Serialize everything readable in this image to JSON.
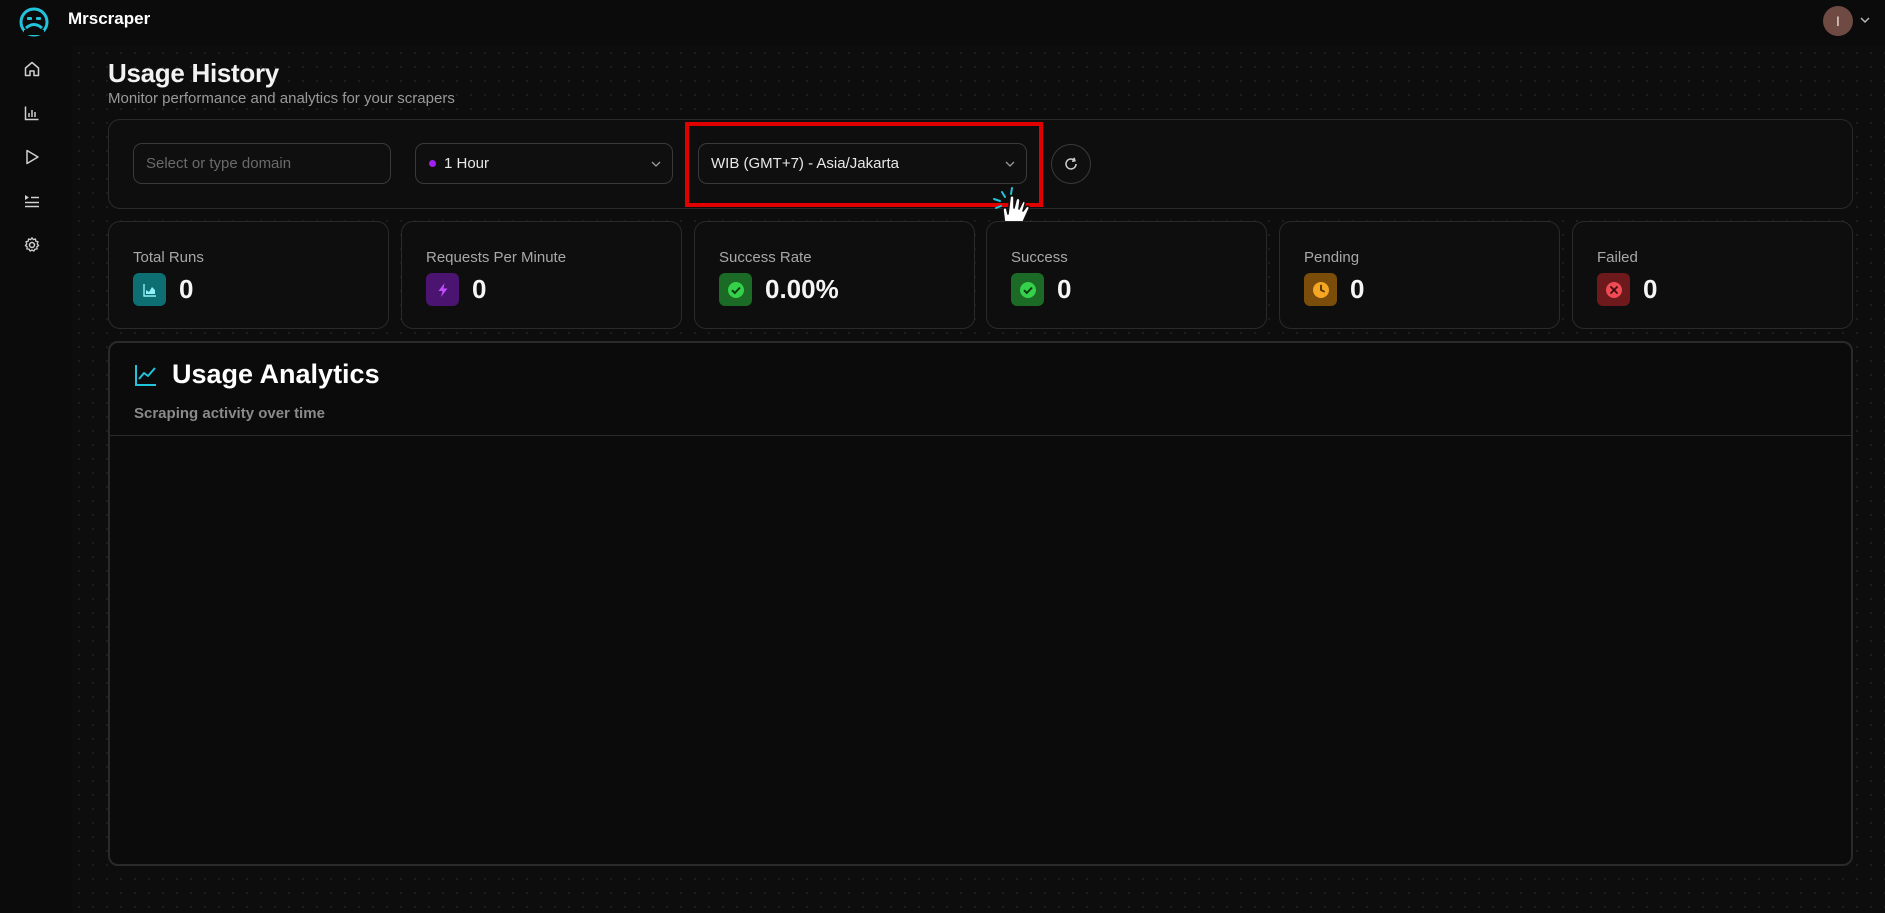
{
  "app": {
    "name": "Mrscraper"
  },
  "user": {
    "avatar_initial": "I"
  },
  "sidebar": {
    "items": [
      {
        "name": "home",
        "icon": "home-icon"
      },
      {
        "name": "usage",
        "icon": "bar-chart-icon"
      },
      {
        "name": "run",
        "icon": "play-icon"
      },
      {
        "name": "queue",
        "icon": "list-icon"
      },
      {
        "name": "settings",
        "icon": "gear-icon"
      }
    ]
  },
  "page": {
    "title": "Usage History",
    "subtitle": "Monitor performance and analytics for your scrapers"
  },
  "filters": {
    "domain_placeholder": "Select or type domain",
    "time_range": "1 Hour",
    "timezone": "WIB (GMT+7) - Asia/Jakarta"
  },
  "stats": [
    {
      "label": "Total Runs",
      "value": "0",
      "icon": "area-chart-icon",
      "color": "#0e6f73"
    },
    {
      "label": "Requests Per Minute",
      "value": "0",
      "icon": "lightning-icon",
      "color": "#4a1470"
    },
    {
      "label": "Success Rate",
      "value": "0.00%",
      "icon": "check-circle-icon",
      "color": "#1b6a25"
    },
    {
      "label": "Success",
      "value": "0",
      "icon": "check-circle-icon",
      "color": "#1b6a25"
    },
    {
      "label": "Pending",
      "value": "0",
      "icon": "clock-icon",
      "color": "#7a4e0a"
    },
    {
      "label": "Failed",
      "value": "0",
      "icon": "x-circle-icon",
      "color": "#6e1a1d"
    }
  ],
  "analytics": {
    "title": "Usage Analytics",
    "subtitle": "Scraping activity over time"
  },
  "colors": {
    "accent_cyan": "#22c3dc",
    "highlight_red": "#e00000",
    "purple_dot": "#a020f0"
  }
}
